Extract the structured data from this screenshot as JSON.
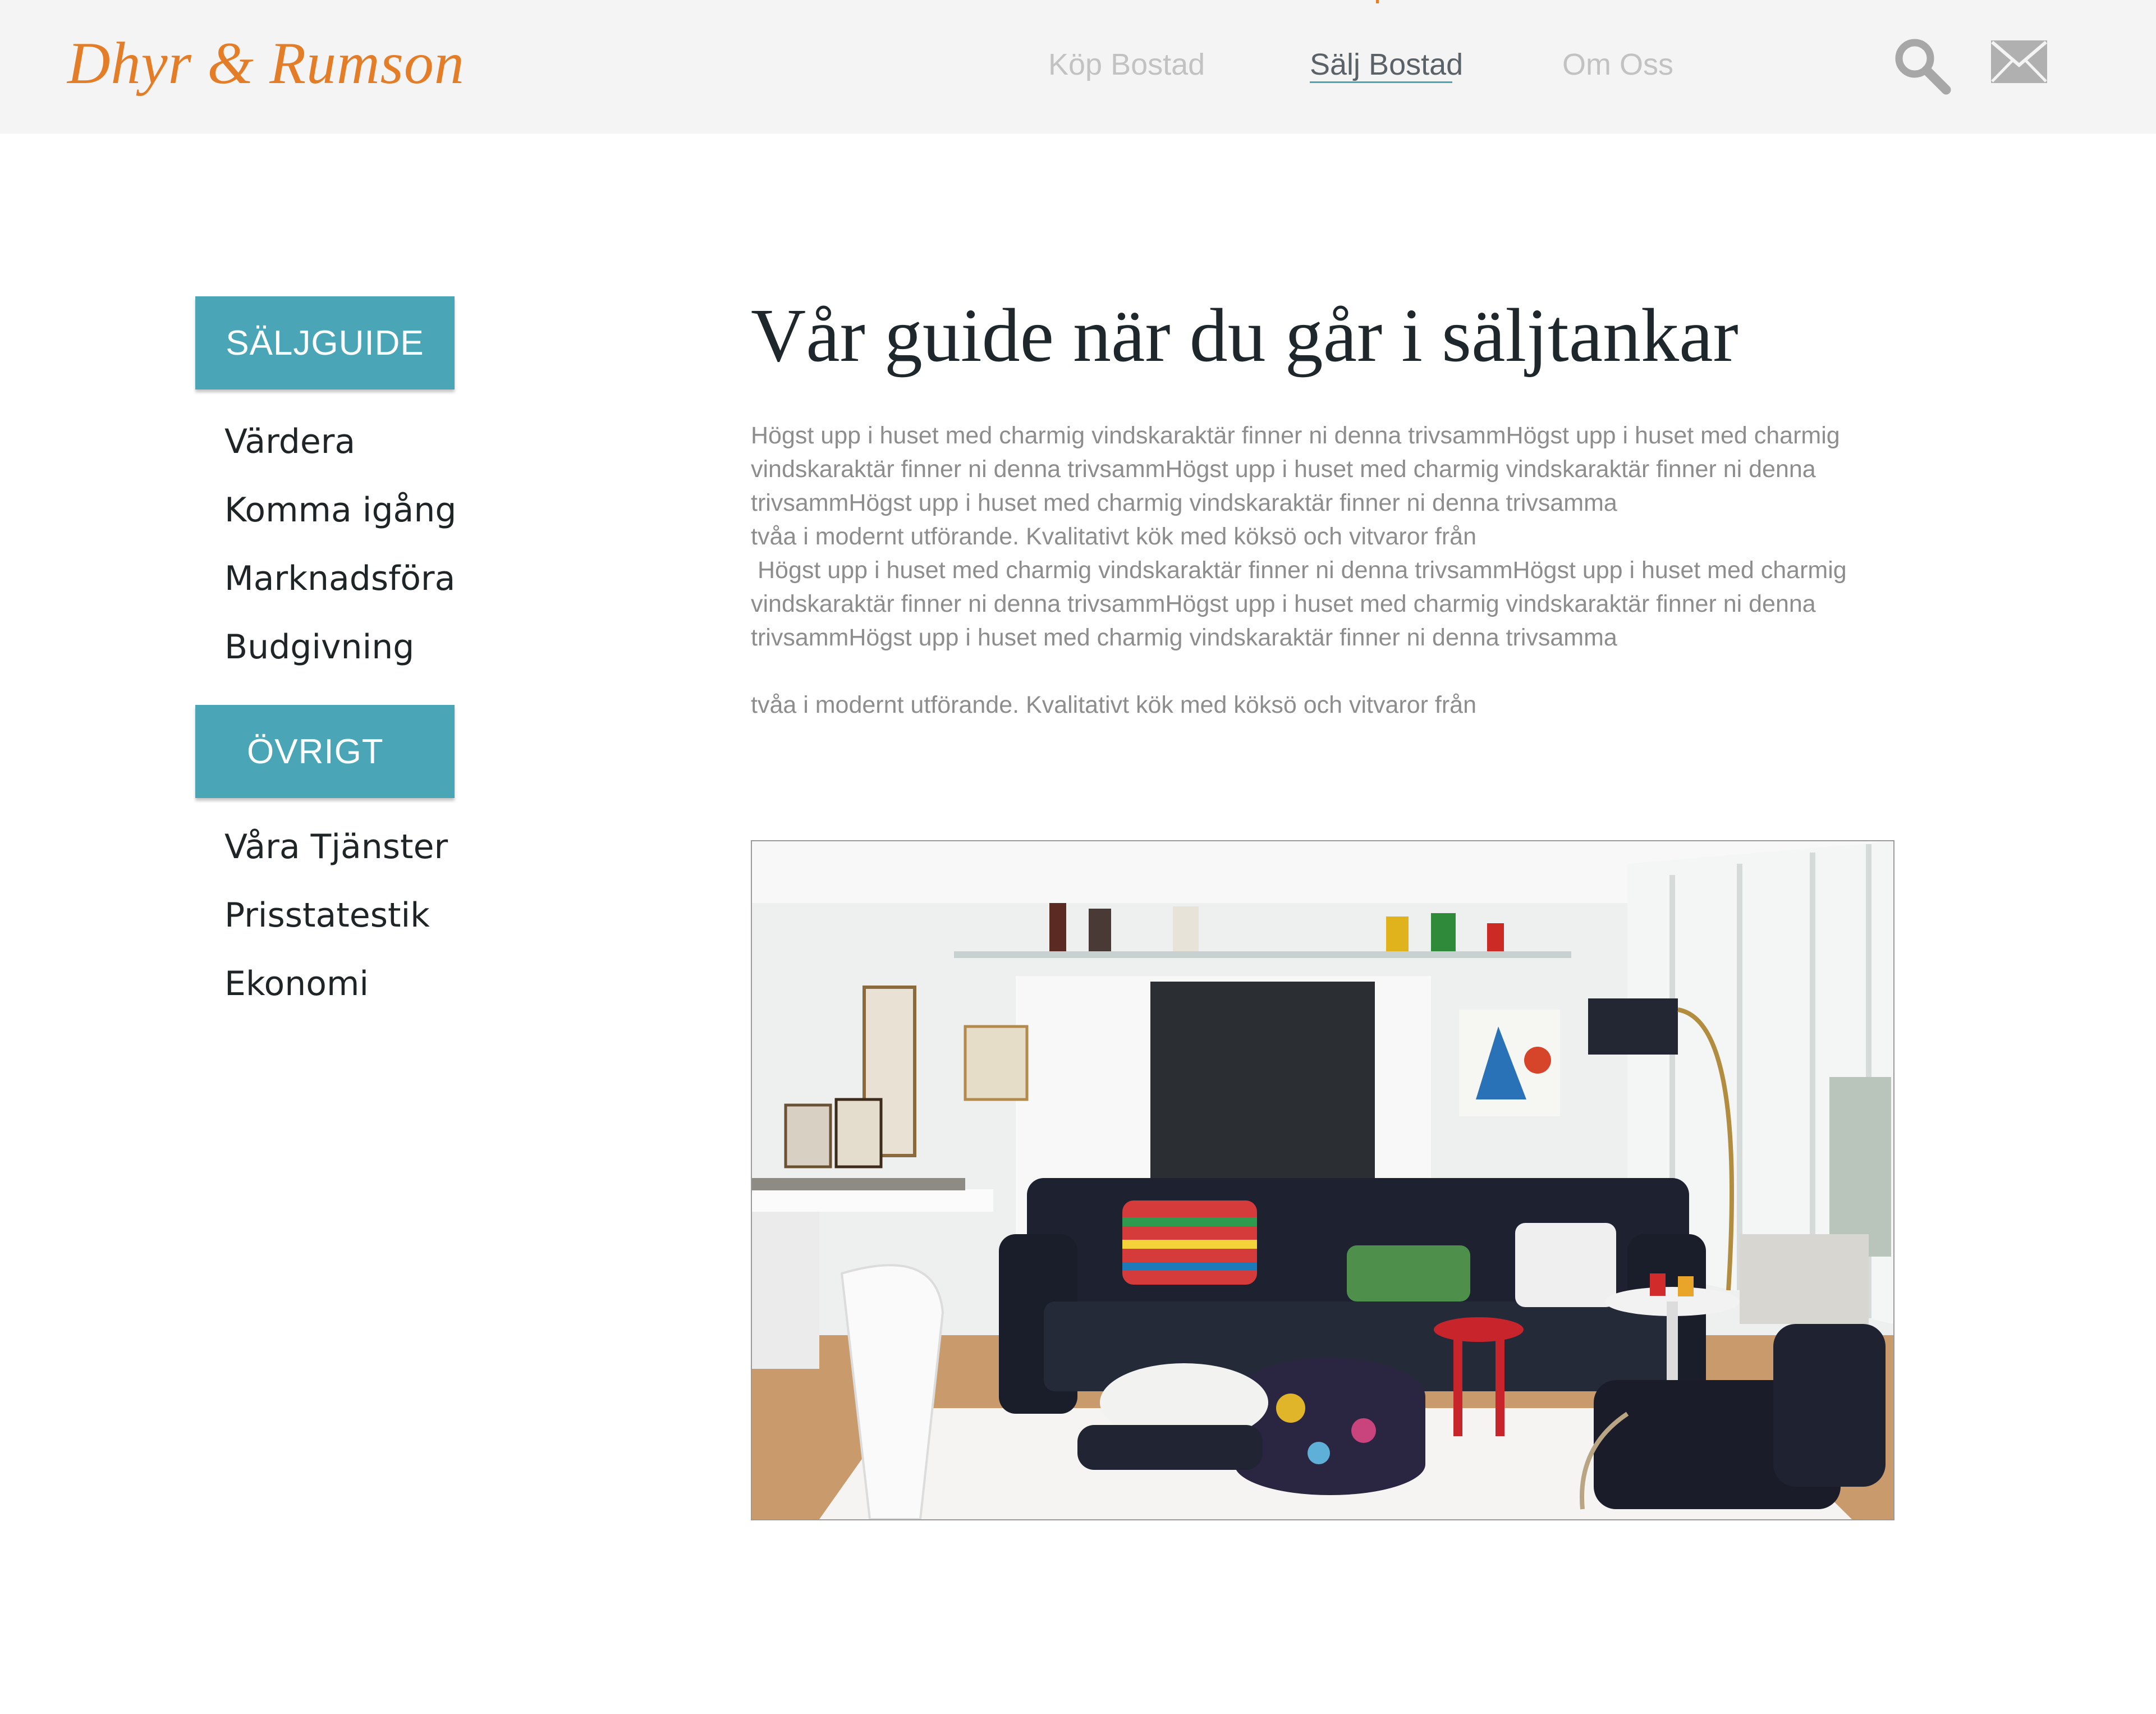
{
  "header": {
    "logo": "Dhyr & Rumson",
    "nav": [
      {
        "label": "Köp Bostad"
      },
      {
        "label": "Sälj Bostad"
      },
      {
        "label": "Om Oss"
      }
    ],
    "active_nav": "Sälj Bostad",
    "icons": [
      "search-icon",
      "mail-icon"
    ]
  },
  "sidebar": {
    "sections": [
      {
        "title": "SÄLJGUIDE",
        "items": [
          "Värdera",
          "Komma igång",
          "Marknadsföra",
          "Budgivning"
        ]
      },
      {
        "title": "ÖVRIGT",
        "items": [
          "Våra Tjänster",
          "Prisstatestik",
          "Ekonomi"
        ]
      }
    ]
  },
  "main": {
    "title": "Vår guide när du går i säljtankar",
    "paragraph_lines": [
      "Högst upp i huset med charmig vindskaraktär finner ni denna trivsammHögst upp i huset med charmig",
      "vindskaraktär finner ni denna trivsammHögst upp i huset med charmig vindskaraktär finner ni denna",
      "trivsammHögst upp i huset med charmig vindskaraktär finner ni denna trivsamma",
      "tvåa i modernt utförande. Kvalitativt kök med köksö och vitvaror från",
      " Högst upp i huset med charmig vindskaraktär finner ni denna trivsammHögst upp i huset med charmig",
      "vindskaraktär finner ni denna trivsammHögst upp i huset med charmig vindskaraktär finner ni denna",
      "trivsammHögst upp i huset med charmig vindskaraktär finner ni denna trivsamma",
      "tvåa i modernt utförande. Kvalitativt kök med köksö och vitvaror från"
    ],
    "image": "living-room-photo"
  },
  "colors": {
    "accent": "#4aa6b6",
    "logo": "#e47d28",
    "header_bg": "#f4f4f4",
    "nav_inactive": "#c2c2c2",
    "nav_active": "#5a6268",
    "body_text": "#8d8d8d",
    "heading": "#1e272c"
  }
}
